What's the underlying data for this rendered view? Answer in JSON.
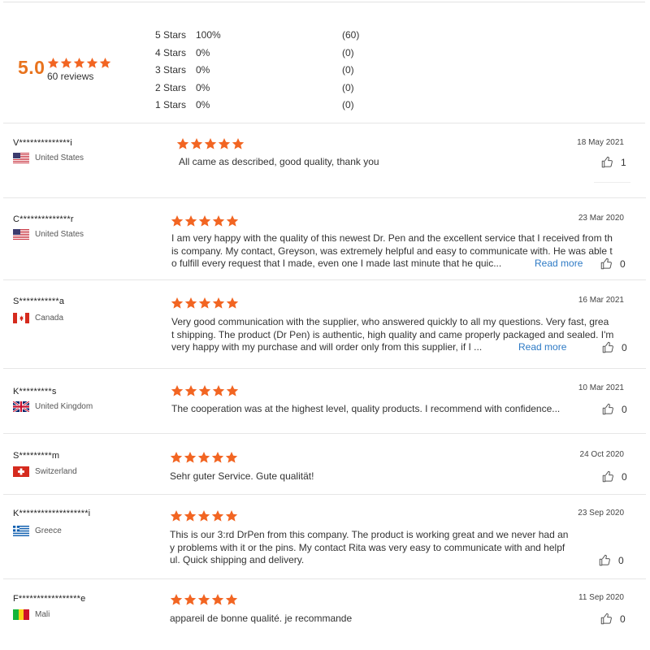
{
  "summary": {
    "score": "5.0",
    "reviews_label": "60 reviews",
    "star_count": 5,
    "distribution": [
      {
        "label": "5 Stars",
        "percent": "100%",
        "count": "(60)"
      },
      {
        "label": "4 Stars",
        "percent": "0%",
        "count": "(0)"
      },
      {
        "label": "3 Stars",
        "percent": "0%",
        "count": "(0)"
      },
      {
        "label": "2 Stars",
        "percent": "0%",
        "count": "(0)"
      },
      {
        "label": "1 Stars",
        "percent": "0%",
        "count": "(0)"
      }
    ]
  },
  "colors": {
    "star": "#f26522",
    "accent": "#e8731e",
    "link": "#2d7ac5"
  },
  "reviews": [
    {
      "user": "V**************i",
      "country": "United States",
      "flag": "us-flag-icon",
      "rating": 5,
      "date": "18 May 2021",
      "lines": [
        "All came as described, good quality, thank you"
      ],
      "read_more": "",
      "likes": "1"
    },
    {
      "user": "C**************r",
      "country": "United States",
      "flag": "us-flag-icon",
      "rating": 5,
      "date": "23 Mar 2020",
      "lines": [
        "I am very happy with the quality of this newest Dr. Pen and the excellent service that I received from th",
        "is company. My contact, Greyson, was extremely helpful and easy to communicate with. He was able t",
        "o fulfill every request that I made, even one I made last minute that he quic..."
      ],
      "read_more": "Read more",
      "likes": "0"
    },
    {
      "user": "S***********a",
      "country": "Canada",
      "flag": "canada-flag-icon",
      "rating": 5,
      "date": "16 Mar 2021",
      "lines": [
        "Very good communication with the supplier, who answered quickly to all my questions. Very fast, grea",
        "t shipping. The product (Dr Pen) is authentic, high quality and came properly packaged and sealed. I'm",
        "very happy with my purchase and will order only from this supplier, if I ..."
      ],
      "read_more": "Read more",
      "likes": "0"
    },
    {
      "user": "K*********s",
      "country": "United Kingdom",
      "flag": "uk-flag-icon",
      "rating": 5,
      "date": "10 Mar 2021",
      "lines": [
        "The cooperation was at the highest level, quality products.  I recommend with confidence..."
      ],
      "read_more": "",
      "likes": "0"
    },
    {
      "user": "S*********m",
      "country": "Switzerland",
      "flag": "swiss-flag-icon",
      "rating": 5,
      "date": "24 Oct 2020",
      "lines": [
        "Sehr guter Service. Gute qualität!"
      ],
      "read_more": "",
      "likes": "0"
    },
    {
      "user": "K*******************i",
      "country": "Greece",
      "flag": "greece-flag-icon",
      "rating": 5,
      "date": "23 Sep 2020",
      "lines": [
        "This is our 3:rd DrPen from this company. The product is working great and we never had an",
        "y problems with it or the pins. My contact Rita was very easy to communicate with and helpf",
        "ul. Quick shipping and delivery."
      ],
      "read_more": "",
      "likes": "0"
    },
    {
      "user": "F*****************e",
      "country": "Mali",
      "flag": "mali-flag-icon",
      "rating": 5,
      "date": "11 Sep 2020",
      "lines": [
        "appareil de bonne qualité. je recommande"
      ],
      "read_more": "",
      "likes": "0"
    }
  ]
}
